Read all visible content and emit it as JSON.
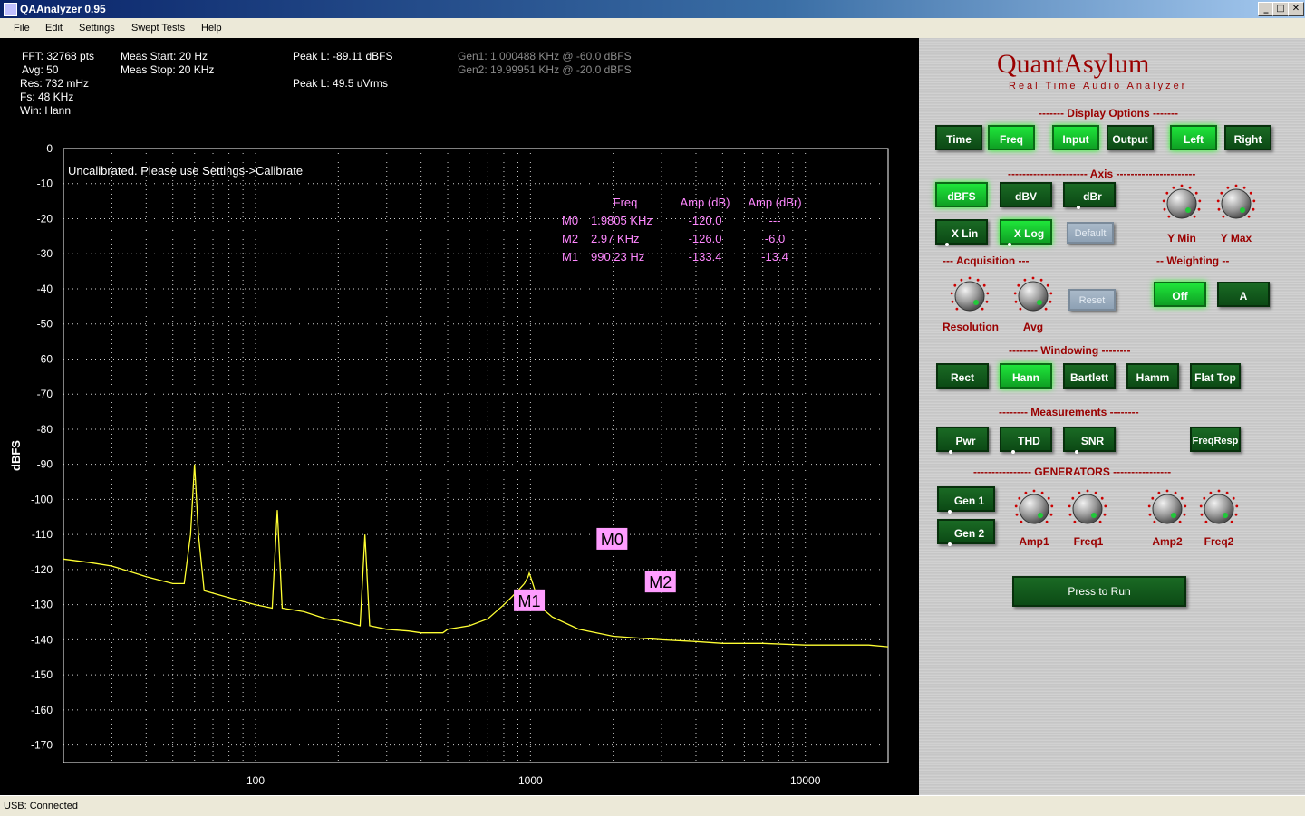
{
  "window": {
    "title": "QAAnalyzer 0.95"
  },
  "menu": [
    "File",
    "Edit",
    "Settings",
    "Swept Tests",
    "Help"
  ],
  "info": {
    "fft": "FFT: 32768 pts",
    "avg": "Avg: 50",
    "res": "Res: 732 mHz",
    "fs": "Fs: 48 KHz",
    "win": "Win: Hann",
    "meas_start": "Meas Start: 20 Hz",
    "meas_stop": "Meas Stop: 20 KHz",
    "peak_dbfs": "Peak L: -89.11 dBFS",
    "peak_uvrms": "Peak L: 49.5 uVrms",
    "gen1": "Gen1: 1.000488 KHz @ -60.0 dBFS",
    "gen2": "Gen2: 19.99951 KHz @ -20.0 dBFS"
  },
  "plot": {
    "notice": "Uncalibrated. Please use Settings->Calibrate",
    "ylabel": "dBFS",
    "colors": {
      "trace": "#ffff33",
      "marker_bg": "#ff9cff",
      "marker_text": "#ff88ff",
      "grid": "#cfcfcf",
      "frame": "#ffffff"
    }
  },
  "markers": {
    "headers": [
      "Freq",
      "Amp (dB)",
      "Amp (dBr)"
    ],
    "rows": [
      {
        "name": "M0",
        "freq": "1.9805 KHz",
        "amp_db": "-120.0",
        "amp_dbr": "---"
      },
      {
        "name": "M2",
        "freq": "2.97 KHz",
        "amp_db": "-126.0",
        "amp_dbr": "-6.0"
      },
      {
        "name": "M1",
        "freq": "990.23 Hz",
        "amp_db": "-133.4",
        "amp_dbr": "-13.4"
      }
    ]
  },
  "chart_data": {
    "type": "line",
    "ylabel": "dBFS",
    "xscale": "log",
    "xlim": [
      20,
      20000
    ],
    "ylim": [
      -175,
      0
    ],
    "yticks": [
      0,
      -10,
      -20,
      -30,
      -40,
      -50,
      -60,
      -70,
      -80,
      -90,
      -100,
      -110,
      -120,
      -130,
      -140,
      -150,
      -160,
      -170
    ],
    "xticks": [
      100,
      1000,
      10000
    ],
    "grid": true,
    "series": [
      {
        "x": [
          20,
          25,
          30,
          40,
          50,
          55,
          58,
          60,
          62,
          65,
          80,
          100,
          115,
          120,
          125,
          150,
          180,
          200,
          240,
          250,
          260,
          300,
          360,
          400,
          480,
          500,
          600,
          700,
          800,
          850,
          900,
          950,
          980,
          990,
          1000,
          1010,
          1030,
          1060,
          1100,
          1200,
          1500,
          2000,
          3000,
          4000,
          5000,
          7000,
          10000,
          14000,
          17000,
          20000
        ],
        "y": [
          -117,
          -118,
          -119,
          -122,
          -124,
          -124,
          -110,
          -90,
          -110,
          -126,
          -128,
          -130,
          -131,
          -103,
          -131,
          -132,
          -134,
          -134.5,
          -136,
          -110,
          -136,
          -137,
          -137.5,
          -138,
          -138,
          -137,
          -136,
          -134,
          -130,
          -128,
          -126,
          -124,
          -122,
          -121,
          -122,
          -123,
          -125,
          -128,
          -131,
          -133.5,
          -137,
          -139,
          -140,
          -140.5,
          -141,
          -141,
          -141.5,
          -141.5,
          -141.5,
          -142
        ]
      }
    ],
    "markers": [
      {
        "name": "M0",
        "x": 1980.5,
        "y": -120.0
      },
      {
        "name": "M2",
        "x": 2970,
        "y": -126.0
      },
      {
        "name": "M1",
        "x": 990.23,
        "y": -133.4
      }
    ]
  },
  "controls": {
    "brand": "QuantAsylum",
    "subtitle": "Real Time Audio Analyzer",
    "sections": {
      "display": "------- Display Options -------",
      "axis": "---------------------- Axis ----------------------",
      "acquisition": "--- Acquisition ---",
      "weighting": "-- Weighting --",
      "windowing": "--------  Windowing  --------",
      "measurements": "-------- Measurements --------",
      "generators": "---------------- GENERATORS ----------------"
    },
    "display_buttons": [
      "Time",
      "Freq",
      "Input",
      "Output",
      "Left",
      "Right"
    ],
    "axis_buttons": [
      "dBFS",
      "dBV",
      "dBr",
      "X Lin",
      "X Log",
      "Default"
    ],
    "axis_knobs": [
      "Y Min",
      "Y Max"
    ],
    "acq_knobs": [
      "Resolution",
      "Avg"
    ],
    "acq_reset": "Reset",
    "weighting_buttons": [
      "Off",
      "A"
    ],
    "windowing_buttons": [
      "Rect",
      "Hann",
      "Bartlett",
      "Hamm",
      "Flat Top"
    ],
    "measurement_buttons": [
      "Pwr",
      "THD",
      "SNR",
      "FreqResp"
    ],
    "gen_buttons": [
      "Gen 1",
      "Gen 2"
    ],
    "gen_knobs": [
      "Amp1",
      "Freq1",
      "Amp2",
      "Freq2"
    ],
    "run": "Press to Run"
  },
  "status": "USB: Connected"
}
